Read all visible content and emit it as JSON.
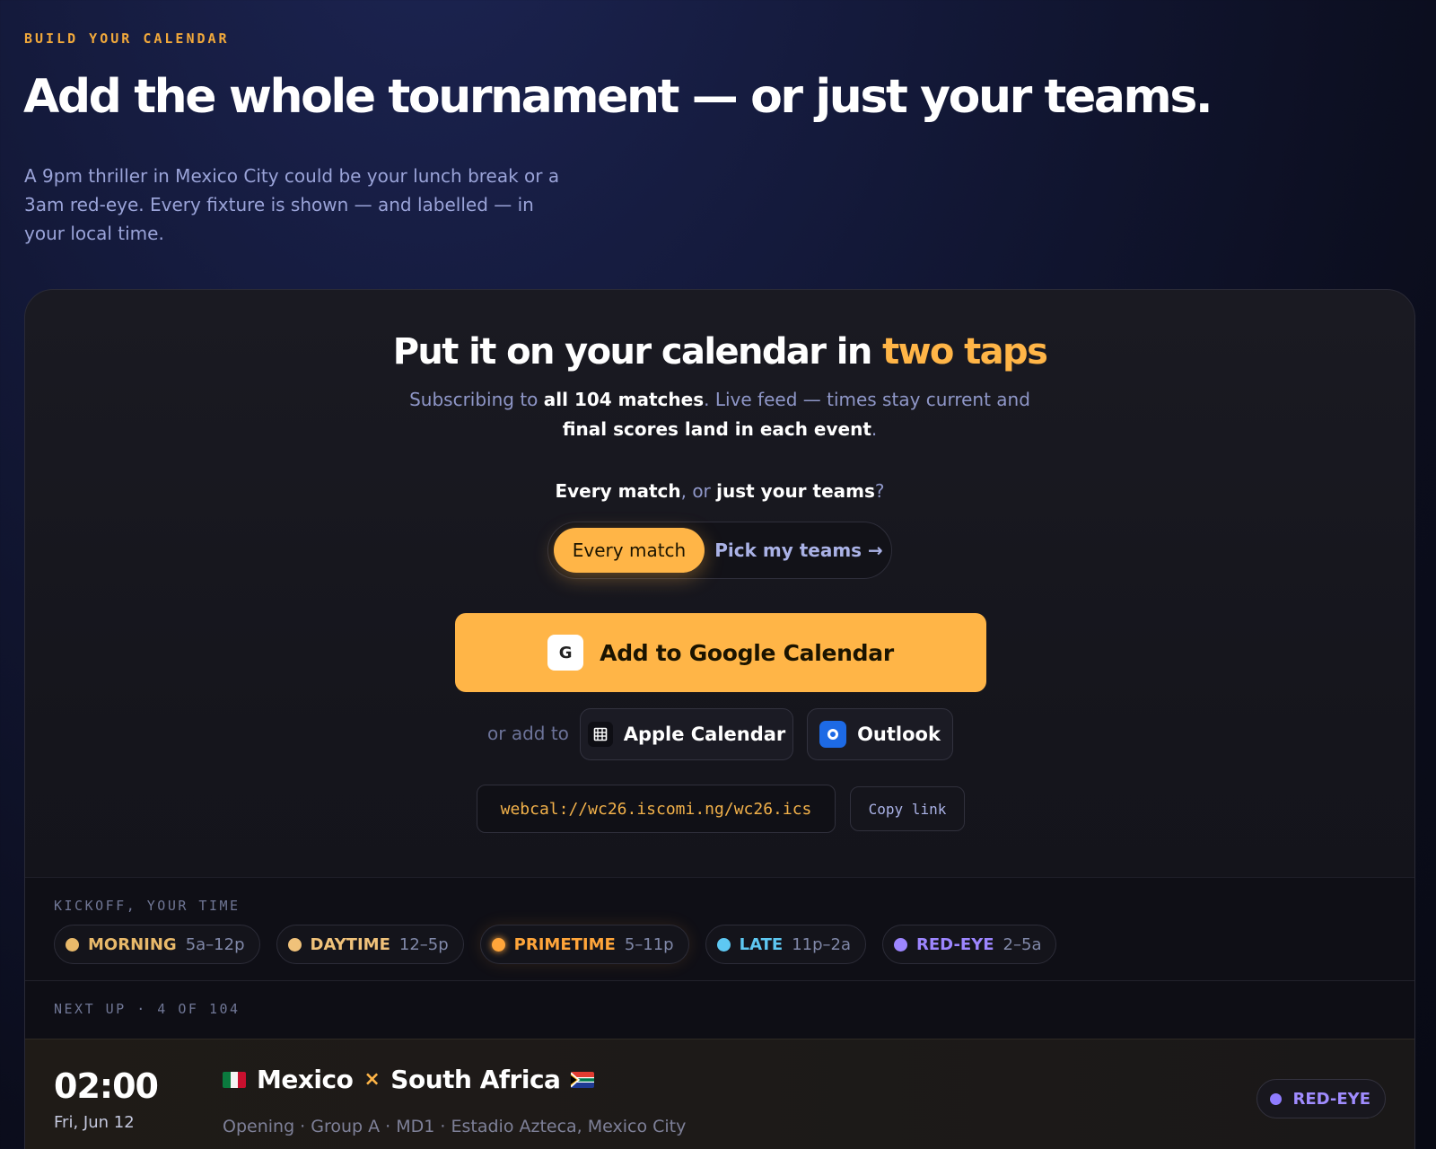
{
  "header": {
    "eyebrow": "BUILD YOUR CALENDAR",
    "title": "Add the whole tournament — or just your teams.",
    "subtitle": "A 9pm thriller in Mexico City could be your lunch break or a 3am red-eye. Every fixture is shown — and labelled — in your local time."
  },
  "panel": {
    "title_main": "Put it on your calendar in ",
    "title_accent": "two taps",
    "desc_pre": "Subscribing to ",
    "desc_bold1": "all 104 matches",
    "desc_mid": ". Live feed — times stay current and ",
    "desc_bold2": "final scores land in each event",
    "desc_post": ".",
    "question_bold1": "Every match",
    "question_mid": ", or ",
    "question_bold2": "just your teams",
    "question_post": "?",
    "toggle": {
      "active": "Every match",
      "inactive": "Pick my teams →"
    },
    "google_button": {
      "icon_letter": "G",
      "label": "Add to Google Calendar"
    },
    "or_add_to": "or add to",
    "apple_button": {
      "icon": "calendar-icon",
      "label": "Apple Calendar"
    },
    "outlook_button": {
      "icon": "outlook-icon",
      "label": "Outlook"
    },
    "feed_url": "webcal://wc26.iscomi.ng/wc26.ics",
    "copy_label": "Copy link"
  },
  "kickoff": {
    "label": "KICKOFF, YOUR TIME",
    "bands": [
      {
        "name": "MORNING",
        "range": "5a–12p",
        "color": "#e8b96a"
      },
      {
        "name": "DAYTIME",
        "range": "12–5p",
        "color": "#f0c27a"
      },
      {
        "name": "PRIMETIME",
        "range": "5–11p",
        "color": "#ffa53a"
      },
      {
        "name": "LATE",
        "range": "11p–2a",
        "color": "#5ec8f2"
      },
      {
        "name": "RED-EYE",
        "range": "2–5a",
        "color": "#9d86ff"
      }
    ]
  },
  "next_up": {
    "label": "NEXT UP · 4 OF 104",
    "matches": [
      {
        "time": "02:00",
        "date": "Fri, Jun 12",
        "home": "Mexico",
        "away": "South Africa",
        "separator": "×",
        "meta": "Opening · Group A · MD1 · Estadio Azteca, Mexico City",
        "badge": "RED-EYE",
        "badge_color": "#9d86ff"
      }
    ]
  }
}
